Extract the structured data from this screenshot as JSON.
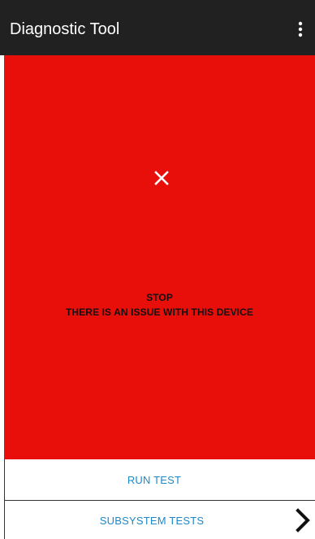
{
  "appbar": {
    "title": "Diagnostic Tool",
    "menu_icon": "more-vert-icon"
  },
  "status": {
    "icon": "close-icon",
    "line1": "STOP",
    "line2": "THERE IS AN ISSUE WITH THIS DEVICE",
    "background_color": "#e80e0a"
  },
  "actions": {
    "run_test_label": "RUN TEST",
    "subsystem_tests_label": "SUBSYSTEM TESTS",
    "subsystem_icon": "chevron-right-icon",
    "accent_color": "#1e88c8"
  }
}
